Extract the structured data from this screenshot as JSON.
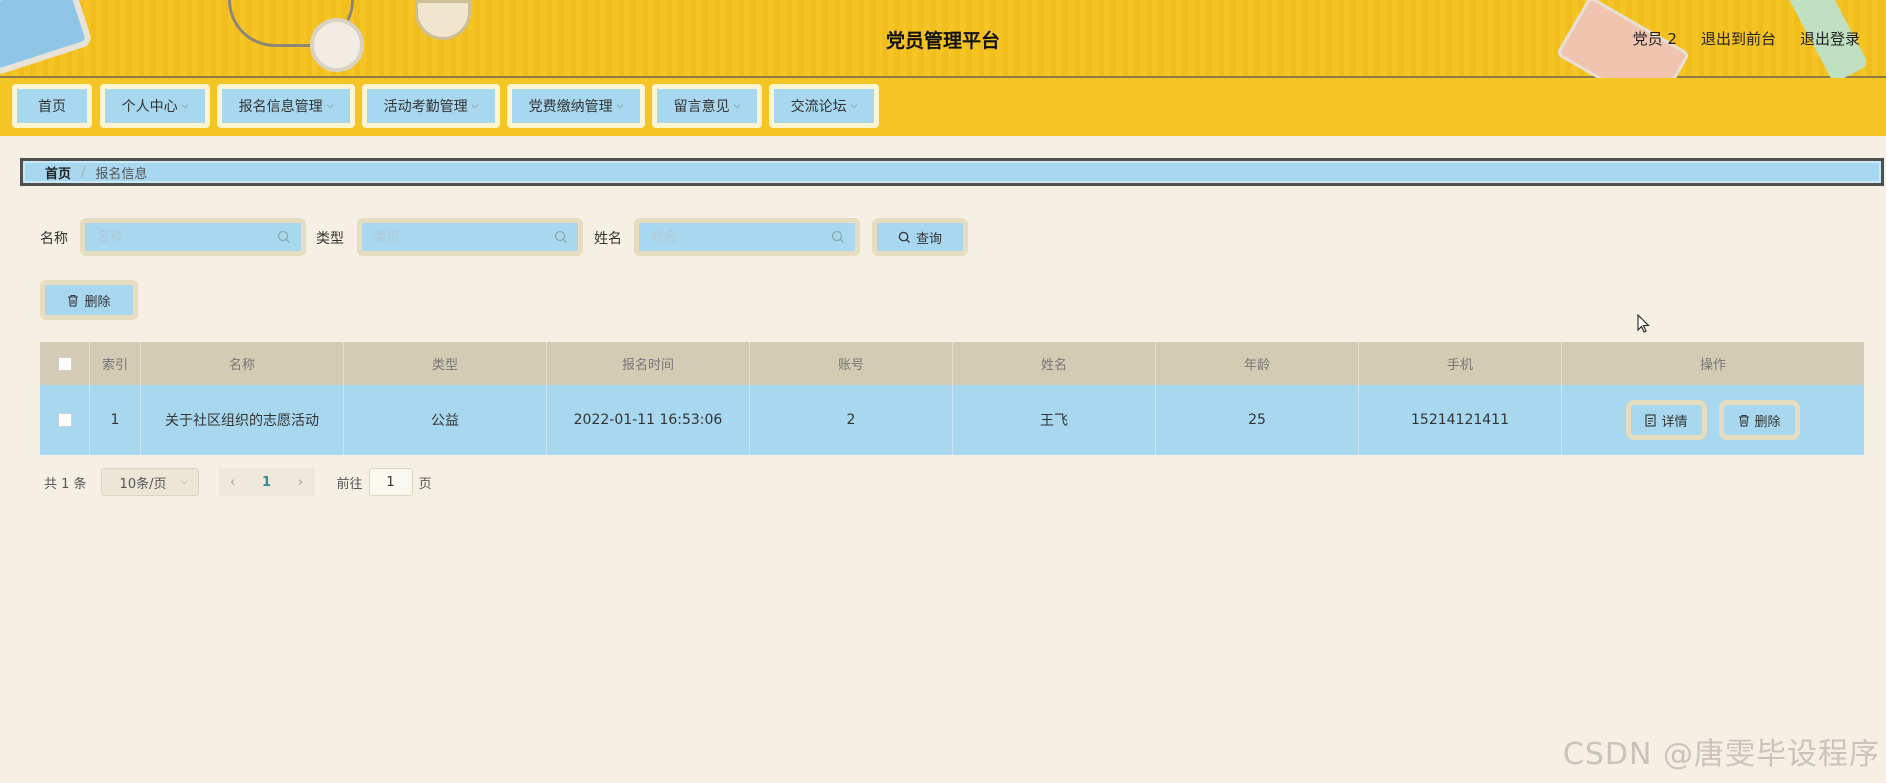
{
  "header": {
    "title": "党员管理平台",
    "links": [
      "党员 2",
      "退出到前台",
      "退出登录"
    ]
  },
  "nav": [
    {
      "label": "首页",
      "dropdown": false
    },
    {
      "label": "个人中心",
      "dropdown": true
    },
    {
      "label": "报名信息管理",
      "dropdown": true
    },
    {
      "label": "活动考勤管理",
      "dropdown": true
    },
    {
      "label": "党费缴纳管理",
      "dropdown": true
    },
    {
      "label": "留言意见",
      "dropdown": true
    },
    {
      "label": "交流论坛",
      "dropdown": true
    }
  ],
  "breadcrumb": {
    "home": "首页",
    "separator": "/",
    "current": "报名信息"
  },
  "search": {
    "name_label": "名称",
    "name_placeholder": "名称",
    "type_label": "类型",
    "type_placeholder": "类型",
    "person_label": "姓名",
    "person_placeholder": "姓名",
    "query_button": "查询"
  },
  "toolbar": {
    "delete_label": "删除"
  },
  "table": {
    "columns": [
      "",
      "索引",
      "名称",
      "类型",
      "报名时间",
      "账号",
      "姓名",
      "年龄",
      "手机",
      "操作"
    ],
    "rows": [
      {
        "index": "1",
        "name": "关于社区组织的志愿活动",
        "type": "公益",
        "time": "2022-01-11 16:53:06",
        "account": "2",
        "person": "王飞",
        "age": "25",
        "phone": "15214121411"
      }
    ],
    "row_actions": {
      "detail": "详情",
      "delete": "删除"
    }
  },
  "pagination": {
    "total": "共 1 条",
    "page_size": "10条/页",
    "current_page": "1",
    "goto_label": "前往",
    "goto_value": "1",
    "page_suffix": "页"
  },
  "watermark": "CSDN @唐雯毕设程序",
  "colors": {
    "header_yellow": "#f5c526",
    "accent_blue": "#a8d8f0",
    "page_bg": "#f5f0e3",
    "table_header": "#d3cbb3"
  }
}
